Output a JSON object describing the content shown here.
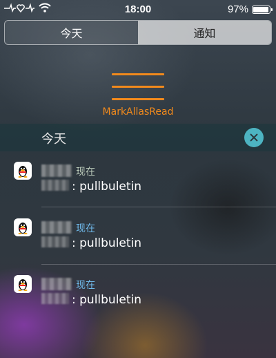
{
  "status_bar": {
    "time": "18:00",
    "battery_percent": "97%",
    "battery_level": 0.97,
    "icons": [
      "heartbeat-icon",
      "wifi-icon",
      "battery-icon"
    ]
  },
  "tabs": [
    {
      "label": "今天",
      "active": false
    },
    {
      "label": "通知",
      "active": true
    }
  ],
  "menu": {
    "label": "MarkAllasRead",
    "accent_color": "#f28a1c",
    "icon": "hamburger-icon"
  },
  "section": {
    "title": "今天",
    "clear_icon": "close-icon"
  },
  "notifications": [
    {
      "app_icon": "qq-penguin-icon",
      "time": "现在",
      "message": ": pullbuletin",
      "time_color": "#b9c8b8"
    },
    {
      "app_icon": "qq-penguin-icon",
      "time": "现在",
      "message": ": pullbuletin",
      "time_color": "#6fb9ea"
    },
    {
      "app_icon": "qq-penguin-icon",
      "time": "现在",
      "message": ": pullbuletin",
      "time_color": "#6fb9ea"
    }
  ]
}
